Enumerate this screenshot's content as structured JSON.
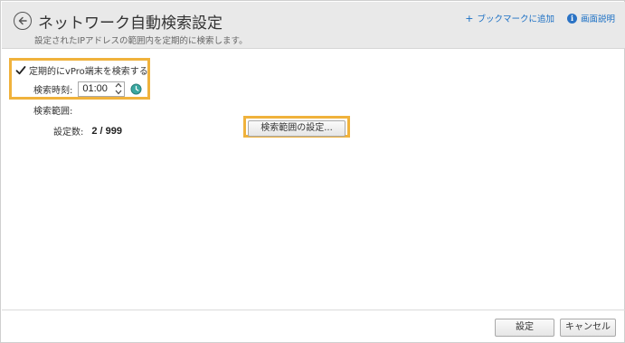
{
  "header": {
    "title": "ネットワーク自動検索設定",
    "subtitle": "設定されたIPアドレスの範囲内を定期的に検索します。",
    "bookmark_link": "ブックマークに追加",
    "help_link": "画面説明"
  },
  "schedule": {
    "checkbox_label": "定期的にvPro端末を検索する",
    "checked": true,
    "time_label": "検索時刻:",
    "time_value": "01:00"
  },
  "range": {
    "label": "検索範囲:",
    "count_label": "設定数:",
    "count_value": "2 / 999",
    "settings_button": "検索範囲の設定..."
  },
  "footer": {
    "ok_label": "設定",
    "cancel_label": "キャンセル"
  },
  "colors": {
    "highlight": "#f0b23c",
    "link": "#1a6fc4",
    "header_bg": "#e9e9e9"
  },
  "icons": {
    "back": "back-arrow-circle-icon",
    "add": "plus-icon",
    "info": "info-icon",
    "checkbox": "checkmark-icon",
    "spin_up": "chevron-up-icon",
    "spin_down": "chevron-down-icon",
    "clock": "clock-icon"
  }
}
